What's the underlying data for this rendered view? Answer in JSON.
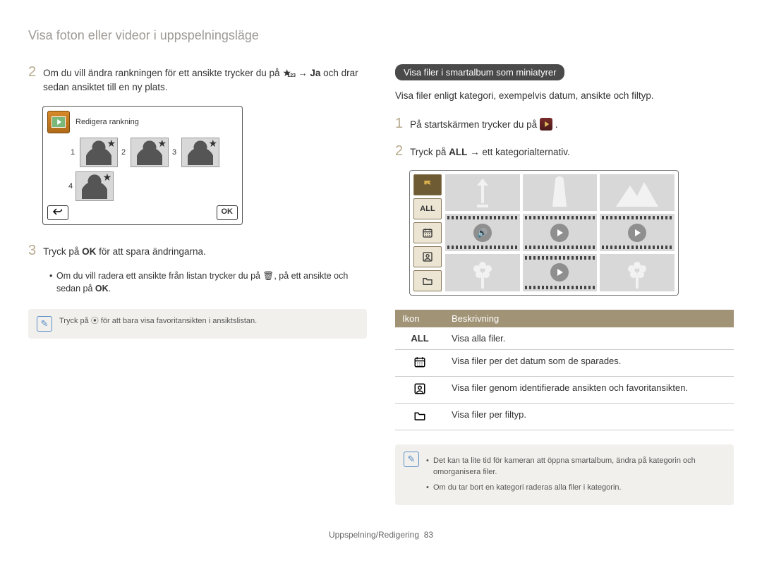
{
  "page_title": "Visa foton eller videor i uppspelningsläge",
  "left": {
    "step2": {
      "num": "2",
      "text_a": "Om du vill ändra rankningen för ett ansikte trycker du på",
      "text_ja": "Ja",
      "text_b": " och drar sedan ansiktet till en ny plats."
    },
    "ui_title": "Redigera rankning",
    "ranks": [
      "1",
      "2",
      "3",
      "4"
    ],
    "ok_btn": "OK",
    "step3": {
      "num": "3",
      "text_a": "Tryck på ",
      "ok": "OK",
      "text_b": " för att spara ändringarna."
    },
    "bullet": "Om du vill radera ett ansikte från listan trycker du på 🗑, på ett ansikte och sedan på ",
    "bullet_ok": "OK",
    "bullet_end": ".",
    "note": "Tryck på ⦿ för att bara visa favoritansikten i ansiktslistan."
  },
  "right": {
    "heading": "Visa filer i smartalbum som miniatyrer",
    "intro": "Visa filer enligt kategori, exempelvis datum, ansikte och filtyp.",
    "step1": {
      "num": "1",
      "text_a": "På startskärmen trycker du på ",
      "text_b": "."
    },
    "step2": {
      "num": "2",
      "text_a": "Tryck på ",
      "all": "ALL",
      "text_b": " → ett kategorialternativ."
    },
    "all_label": "ALL",
    "table": {
      "h1": "Ikon",
      "h2": "Beskrivning",
      "rows": [
        {
          "icon": "ALL",
          "desc": "Visa alla filer."
        },
        {
          "icon": "calendar",
          "desc": "Visa filer per det datum som de sparades."
        },
        {
          "icon": "face",
          "desc": "Visa filer genom identifierade ansikten och favoritansikten."
        },
        {
          "icon": "folder",
          "desc": "Visa filer per filtyp."
        }
      ]
    },
    "note": {
      "l1": "Det kan ta lite tid för kameran att öppna smartalbum, ändra på kategorin och omorganisera filer.",
      "l2": "Om du tar bort en kategori raderas alla filer i kategorin."
    }
  },
  "footer": {
    "section": "Uppspelning/Redigering",
    "page": "83"
  }
}
